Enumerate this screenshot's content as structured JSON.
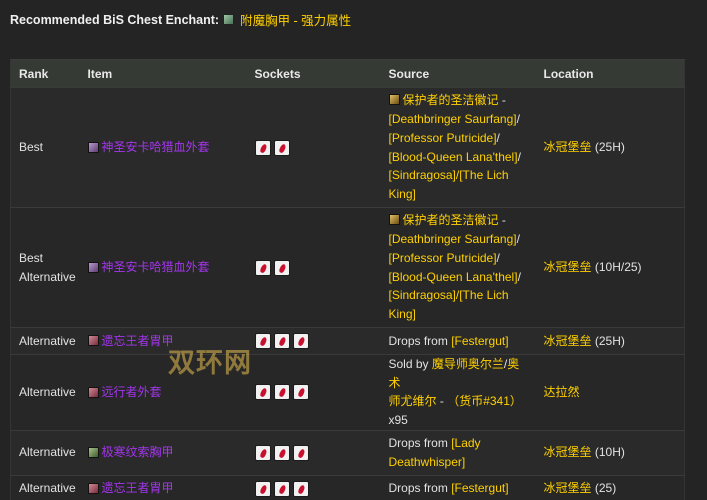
{
  "heading": {
    "label": "Recommended BiS Chest Enchant:",
    "enchant": "附魔胸甲 - 强力属性"
  },
  "columns": [
    "Rank",
    "Item",
    "Sockets",
    "Source",
    "Location"
  ],
  "rows": [
    {
      "rank": [
        "Best"
      ],
      "item": "神圣安卡哈猎血外套",
      "icon": "purple",
      "sockets": 2,
      "source": [
        "保护者的圣洁徽记",
        " -",
        "[Deathbringer Saurfang]",
        "/",
        "[Professor Putricide]",
        "/",
        "[Blood-Queen Lana'thel]",
        "/",
        "[Sindragosa]",
        "/[The Lich",
        "King]"
      ],
      "location": [
        "冰冠堡垒",
        " (25H)"
      ]
    },
    {
      "rank": [
        "Best",
        "Alternative"
      ],
      "item": "神圣安卡哈猎血外套",
      "icon": "purple",
      "sockets": 2,
      "source": [
        "保护者的圣洁徽记",
        " -",
        "[Deathbringer Saurfang]",
        "/",
        "[Professor Putricide]",
        "/",
        "[Blood-Queen Lana'thel]",
        "/",
        "[Sindragosa]",
        "/[The Lich",
        "King]"
      ],
      "location": [
        "冰冠堡垒",
        " (10H/25)"
      ]
    },
    {
      "rank": [
        "Alternative"
      ],
      "item": "遗忘王者胄甲",
      "icon": "red",
      "sockets": 3,
      "source": [
        "Drops from ",
        "[Festergut]"
      ],
      "location": [
        "冰冠堡垒",
        " (25H)"
      ]
    },
    {
      "rank": [
        "Alternative"
      ],
      "item": "远行者外套",
      "icon": "red",
      "sockets": 3,
      "source": [
        "Sold by ",
        "魔导师奥尔兰",
        "/",
        "奥术",
        "师尤维尔",
        " - ",
        "（货币#341）",
        "x95"
      ],
      "location": [
        "达拉然",
        ""
      ]
    },
    {
      "rank": [
        "Alternative"
      ],
      "item": "极寒纹索胸甲",
      "icon": "green",
      "sockets": 3,
      "source": [
        "Drops from ",
        "[Lady",
        "Deathwhisper]"
      ],
      "location": [
        "冰冠堡垒",
        " (10H)"
      ]
    },
    {
      "rank": [
        "Alternative"
      ],
      "item": "遗忘王者胄甲",
      "icon": "red",
      "sockets": 3,
      "source": [
        "Drops from ",
        "[Festergut]"
      ],
      "location": [
        "冰冠堡垒",
        " (25)"
      ]
    }
  ],
  "watermark": "双环网"
}
